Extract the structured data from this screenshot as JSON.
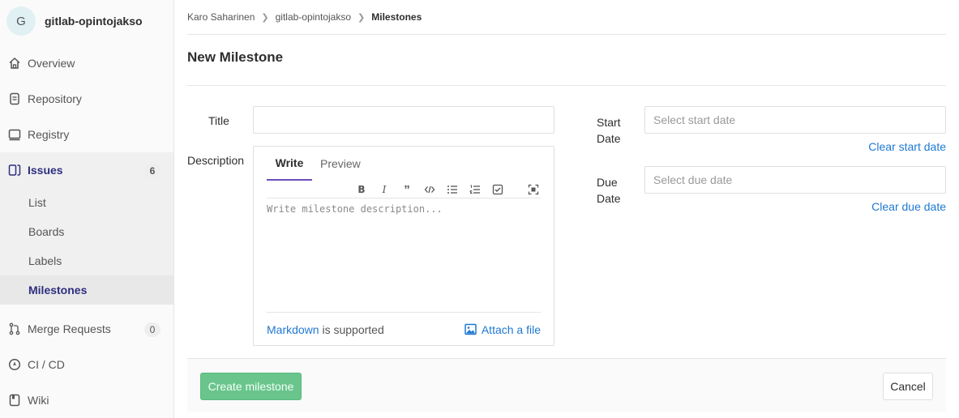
{
  "project": {
    "avatar_letter": "G",
    "name": "gitlab-opintojakso"
  },
  "sidebar": {
    "items": [
      {
        "label": "Overview",
        "icon": "home-icon"
      },
      {
        "label": "Repository",
        "icon": "doc-icon"
      },
      {
        "label": "Registry",
        "icon": "container-icon"
      },
      {
        "label": "Issues",
        "icon": "issues-icon",
        "badge": "6"
      },
      {
        "label": "Merge Requests",
        "icon": "merge-request-icon",
        "badge": "0"
      },
      {
        "label": "CI / CD",
        "icon": "rocket-icon"
      },
      {
        "label": "Wiki",
        "icon": "book-icon"
      }
    ],
    "issues_sub": [
      "List",
      "Boards",
      "Labels",
      "Milestones"
    ]
  },
  "breadcrumb": [
    "Karo Saharinen",
    "gitlab-opintojakso",
    "Milestones"
  ],
  "page": {
    "title": "New Milestone"
  },
  "form": {
    "title_label": "Title",
    "title_value": "",
    "description_label": "Description",
    "tabs": [
      "Write",
      "Preview"
    ],
    "description_placeholder": "Write milestone description...",
    "markdown_link": "Markdown",
    "markdown_suffix": " is supported",
    "attach_label": "Attach a file",
    "start_label_1": "Start",
    "start_label_2": "Date",
    "start_placeholder": "Select start date",
    "clear_start": "Clear start date",
    "due_label_1": "Due",
    "due_label_2": "Date",
    "due_placeholder": "Select due date",
    "clear_due": "Clear due date"
  },
  "actions": {
    "create": "Create milestone",
    "cancel": "Cancel"
  },
  "colors": {
    "accent": "#6b4fbb",
    "link": "#1f78d1",
    "create_button": "#69c58c",
    "active_nav": "#2e2e80"
  }
}
